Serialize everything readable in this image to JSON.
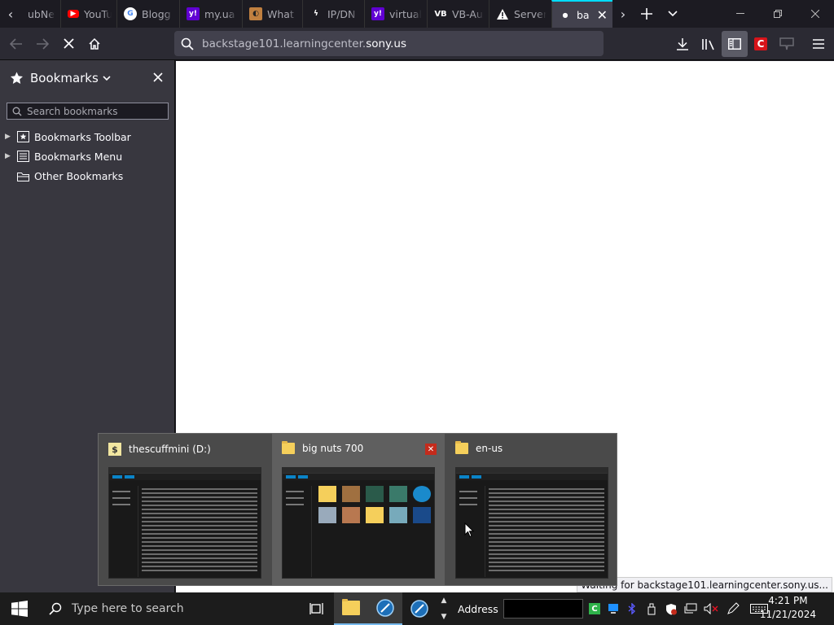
{
  "tabs": [
    {
      "label": "ubNet",
      "icon": "unknown"
    },
    {
      "label": "YouTu",
      "icon": "youtube"
    },
    {
      "label": "Blogg",
      "icon": "google"
    },
    {
      "label": "my.ua",
      "icon": "yahoo"
    },
    {
      "label": "What",
      "icon": "spy"
    },
    {
      "label": "IP/DN",
      "icon": "bolt"
    },
    {
      "label": "virtual",
      "icon": "yahoo"
    },
    {
      "label": "VB-Au",
      "icon": "vb"
    },
    {
      "label": "Server",
      "icon": "warning"
    },
    {
      "label": "ba",
      "icon": "loading",
      "active": true
    }
  ],
  "url": {
    "prefix": "backstage101.learningcenter.",
    "host": "sony.us"
  },
  "sidebar": {
    "title": "Bookmarks",
    "search_placeholder": "Search bookmarks",
    "items": [
      {
        "label": "Bookmarks Toolbar"
      },
      {
        "label": "Bookmarks Menu"
      },
      {
        "label": "Other Bookmarks"
      }
    ]
  },
  "status": "Waiting for backstage101.learningcenter.sony.us...",
  "previews": [
    {
      "title": "thescuffmini (D:)"
    },
    {
      "title": "big nuts 700"
    },
    {
      "title": "en-us"
    }
  ],
  "taskbar": {
    "search_placeholder": "Type here to search",
    "address_label": "Address",
    "time": "4:21 PM",
    "date": "11/21/2024"
  },
  "colors": {
    "accent": "#00ddff",
    "taskbar_active": "#76b9ed",
    "folder": "#f5cf5b",
    "close_red": "#c42b1c"
  }
}
